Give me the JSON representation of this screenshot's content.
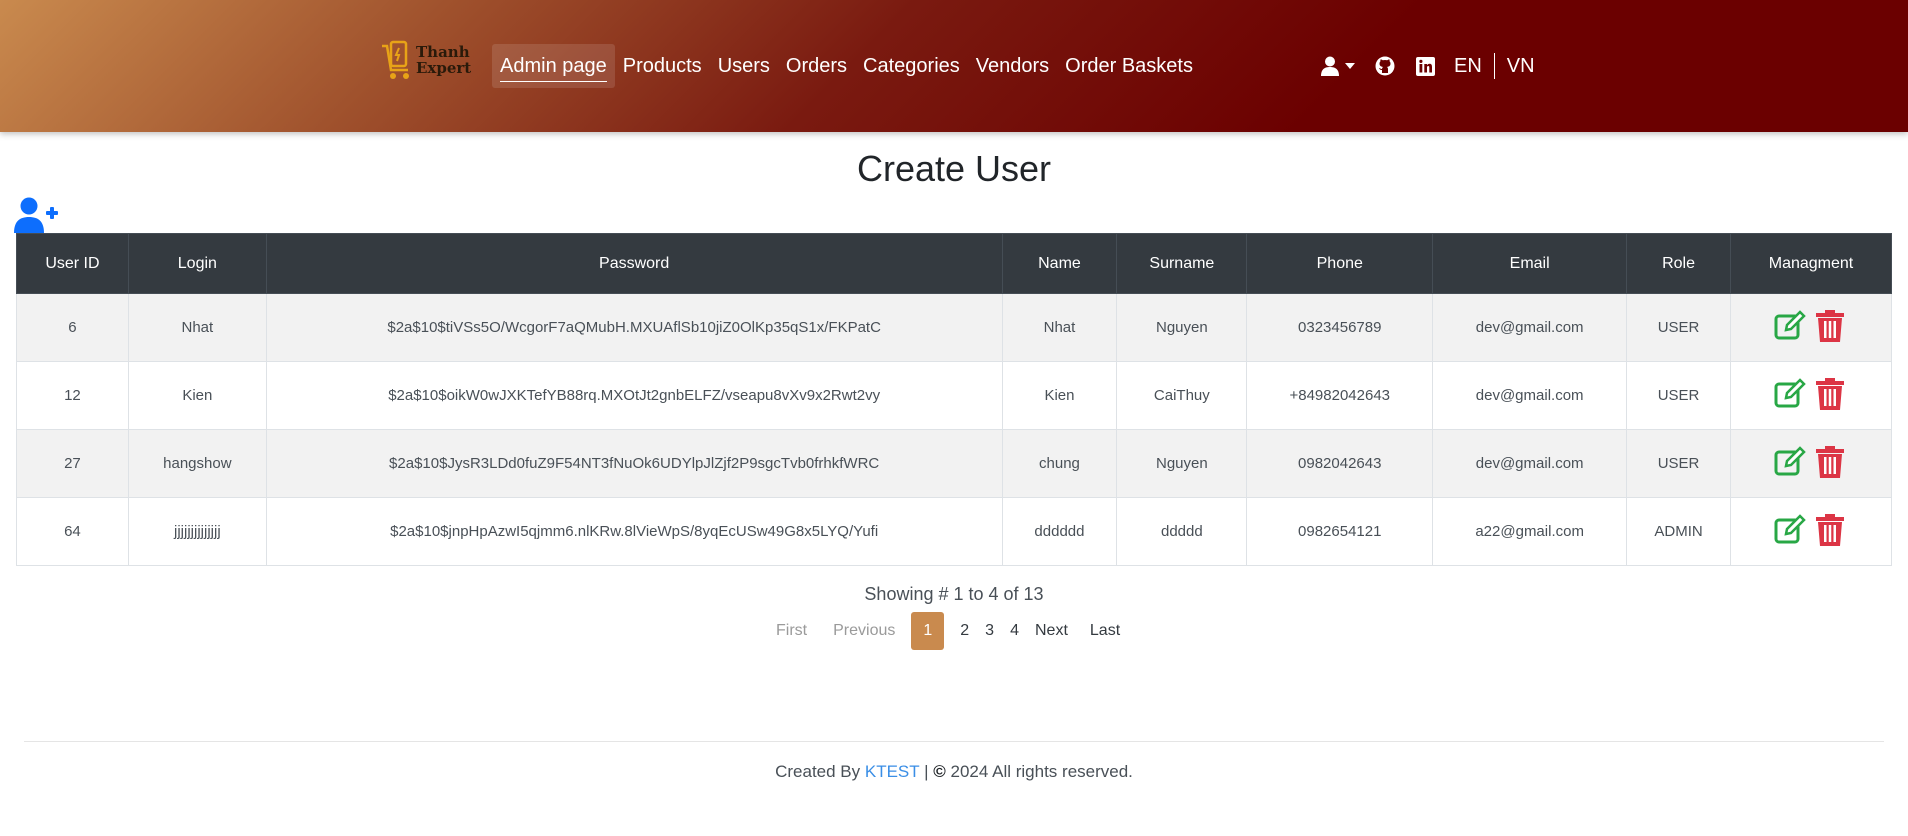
{
  "brand": {
    "line1": "Thanh",
    "line2": "Expert"
  },
  "nav": {
    "items": [
      {
        "label": "Admin page",
        "active": true
      },
      {
        "label": "Products"
      },
      {
        "label": "Users"
      },
      {
        "label": "Orders"
      },
      {
        "label": "Categories"
      },
      {
        "label": "Vendors"
      },
      {
        "label": "Order Baskets"
      }
    ],
    "icons": [
      "user-icon",
      "github-icon",
      "linkedin-icon"
    ],
    "lang_en": "EN",
    "lang_vn": "VN"
  },
  "page": {
    "title": "Create User"
  },
  "table": {
    "headers": [
      "User ID",
      "Login",
      "Password",
      "Name",
      "Surname",
      "Phone",
      "Email",
      "Role",
      "Managment"
    ],
    "rows": [
      [
        "6",
        "Nhat",
        "$2a$10$tiVSs5O/WcgorF7aQMubH.MXUAflSb10jiZ0OlKp35qS1x/FKPatC",
        "Nhat",
        "Nguyen",
        "0323456789",
        "dev@gmail.com",
        "USER"
      ],
      [
        "12",
        "Kien",
        "$2a$10$oikW0wJXKTefYB88rq.MXOtJt2gnbELFZ/vseapu8vXv9x2Rwt2vy",
        "Kien",
        "CaiThuy",
        "+84982042643",
        "dev@gmail.com",
        "USER"
      ],
      [
        "27",
        "hangshow",
        "$2a$10$JysR3LDd0fuZ9F54NT3fNuOk6UDYlpJlZjf2P9sgcTvb0frhkfWRC",
        "chung",
        "Nguyen",
        "0982042643",
        "dev@gmail.com",
        "USER"
      ],
      [
        "64",
        "jjjjjjjjjjjjjj",
        "$2a$10$jnpHpAzwI5qjmm6.nlKRw.8lVieWpS/8yqEcUSw49G8x5LYQ/Yufi",
        "dddddd",
        "ddddd",
        "0982654121",
        "a22@gmail.com",
        "ADMIN"
      ]
    ]
  },
  "pagination": {
    "showing": "Showing # 1 to 4 of 13",
    "first": "First",
    "previous": "Previous",
    "pages": [
      "1",
      "2",
      "3",
      "4"
    ],
    "current": "1",
    "next": "Next",
    "last": "Last"
  },
  "footer": {
    "prefix": "Created By",
    "link": "KTEST",
    "sep": "|",
    "copy_symbol": "©",
    "suffix": "2024 All rights reserved."
  },
  "colors": {
    "edit": "#28a745",
    "delete": "#dc3545",
    "accent": "#c98a4e",
    "add_user": "#0d6efd"
  }
}
